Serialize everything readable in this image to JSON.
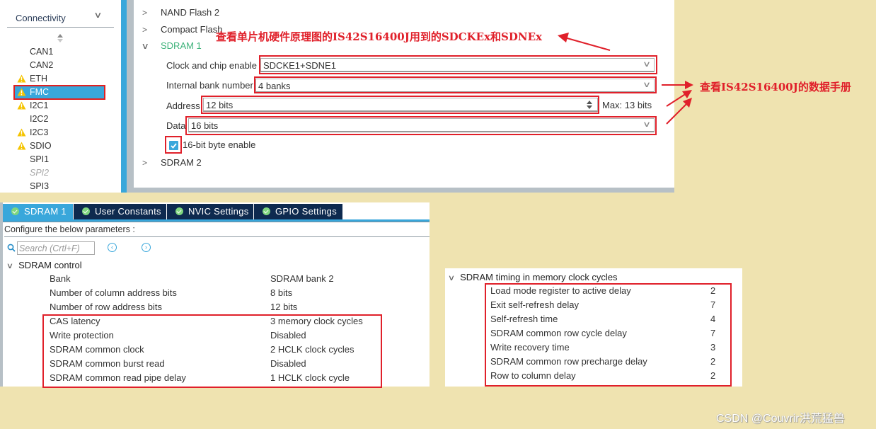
{
  "sidebar": {
    "category": "Connectivity",
    "items": [
      {
        "label": "CAN1",
        "warning": false,
        "selected": false,
        "disabled": false
      },
      {
        "label": "CAN2",
        "warning": false,
        "selected": false,
        "disabled": false
      },
      {
        "label": "ETH",
        "warning": true,
        "selected": false,
        "disabled": false
      },
      {
        "label": "FMC",
        "warning": true,
        "selected": true,
        "disabled": false
      },
      {
        "label": "I2C1",
        "warning": true,
        "selected": false,
        "disabled": false
      },
      {
        "label": "I2C2",
        "warning": false,
        "selected": false,
        "disabled": false
      },
      {
        "label": "I2C3",
        "warning": true,
        "selected": false,
        "disabled": false
      },
      {
        "label": "SDIO",
        "warning": true,
        "selected": false,
        "disabled": false
      },
      {
        "label": "SPI1",
        "warning": false,
        "selected": false,
        "disabled": false
      },
      {
        "label": "SPI2",
        "warning": false,
        "selected": false,
        "disabled": true
      },
      {
        "label": "SPI3",
        "warning": false,
        "selected": false,
        "disabled": false
      }
    ]
  },
  "mode": {
    "tree": [
      {
        "label": "NAND Flash 2",
        "expanded": false
      },
      {
        "label": "Compact Flash",
        "expanded": false
      },
      {
        "label": "SDRAM 1",
        "expanded": true
      },
      {
        "label": "SDRAM 2",
        "expanded": false
      }
    ],
    "fields": {
      "clock_chip_enable": {
        "label": "Clock and chip enable",
        "value": "SDCKE1+SDNE1"
      },
      "internal_bank": {
        "label": "Internal bank number",
        "value": "4 banks"
      },
      "address": {
        "label": "Address",
        "value": "12 bits",
        "max": "Max: 13 bits"
      },
      "data": {
        "label": "Data",
        "value": "16 bits"
      },
      "byte_enable": {
        "label": "16-bit byte enable",
        "checked": true
      }
    }
  },
  "annotations": {
    "schematic_note": "查看单片机硬件原理图的IS42S16400J用到的SDCKEx和SDNEx",
    "datasheet_note": "查看IS42S16400J的数据手册"
  },
  "config": {
    "tabs": [
      {
        "label": "SDRAM 1",
        "active": true
      },
      {
        "label": "User Constants",
        "active": false
      },
      {
        "label": "NVIC Settings",
        "active": false
      },
      {
        "label": "GPIO Settings",
        "active": false
      }
    ],
    "instruction": "Configure the below parameters :",
    "search_placeholder": "Search (Crtl+F)",
    "control": {
      "title": "SDRAM control",
      "params": [
        {
          "name": "Bank",
          "value": "SDRAM bank 2"
        },
        {
          "name": "Number of column address bits",
          "value": "8 bits"
        },
        {
          "name": "Number of row address bits",
          "value": "12 bits"
        },
        {
          "name": "CAS latency",
          "value": "3 memory clock cycles"
        },
        {
          "name": "Write protection",
          "value": "Disabled"
        },
        {
          "name": "SDRAM common clock",
          "value": "2 HCLK clock cycles"
        },
        {
          "name": "SDRAM common burst read",
          "value": "Disabled"
        },
        {
          "name": "SDRAM common read pipe delay",
          "value": "1 HCLK clock cycle"
        }
      ]
    },
    "timing": {
      "title": "SDRAM timing in memory clock cycles",
      "params": [
        {
          "name": "Load mode register to active delay",
          "value": "2"
        },
        {
          "name": "Exit self-refresh delay",
          "value": "7"
        },
        {
          "name": "Self-refresh time",
          "value": "4"
        },
        {
          "name": "SDRAM common row cycle delay",
          "value": "7"
        },
        {
          "name": "Write recovery time",
          "value": "3"
        },
        {
          "name": "SDRAM common row precharge delay",
          "value": "2"
        },
        {
          "name": "Row to column delay",
          "value": "2"
        }
      ]
    }
  },
  "watermark": "CSDN @Couvrir洪荒猛兽",
  "colors": {
    "accent": "#39a7db",
    "highlight_red": "#e0202a",
    "tab_dark": "#0e2a4f",
    "background": "#efe3b0",
    "expanded_green": "#3fb37b"
  }
}
